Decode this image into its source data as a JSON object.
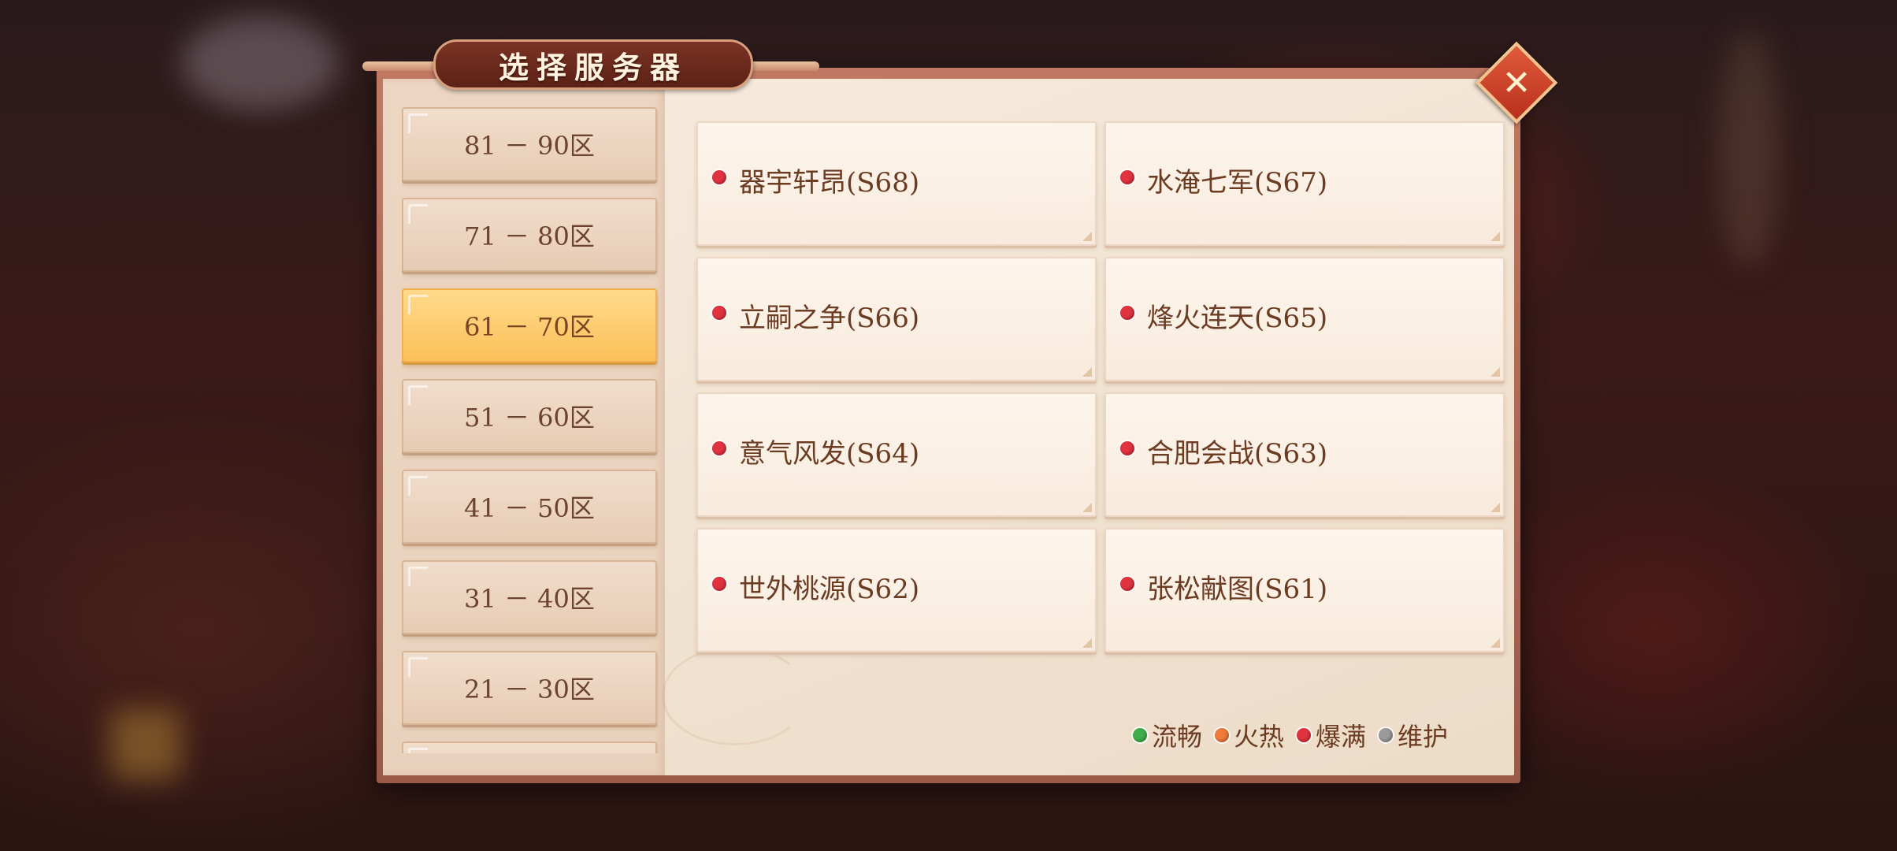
{
  "dialog": {
    "title": "选择服务器",
    "close_label": "✕"
  },
  "colors": {
    "selected_zone": "#fbc15a",
    "status_smooth": "#3fae49",
    "status_hot": "#ef7a3a",
    "status_full": "#e0333f",
    "status_maintenance": "#9a9a9a"
  },
  "zones": [
    {
      "label": "81 － 90区",
      "selected": false
    },
    {
      "label": "71 － 80区",
      "selected": false
    },
    {
      "label": "61 － 70区",
      "selected": true
    },
    {
      "label": "51 － 60区",
      "selected": false
    },
    {
      "label": "41 － 50区",
      "selected": false
    },
    {
      "label": "31 － 40区",
      "selected": false
    },
    {
      "label": "21 － 30区",
      "selected": false
    },
    {
      "label": "",
      "selected": false
    }
  ],
  "servers": [
    {
      "name": "器宇轩昂(S68)",
      "status": "full"
    },
    {
      "name": "水淹七军(S67)",
      "status": "full"
    },
    {
      "name": "立嗣之争(S66)",
      "status": "full"
    },
    {
      "name": "烽火连天(S65)",
      "status": "full"
    },
    {
      "name": "意气风发(S64)",
      "status": "full"
    },
    {
      "name": "合肥会战(S63)",
      "status": "full"
    },
    {
      "name": "世外桃源(S62)",
      "status": "full"
    },
    {
      "name": "张松献图(S61)",
      "status": "full"
    }
  ],
  "legend": [
    {
      "label": "流畅",
      "status": "smooth"
    },
    {
      "label": "火热",
      "status": "hot"
    },
    {
      "label": "爆满",
      "status": "full"
    },
    {
      "label": "维护",
      "status": "maintenance"
    }
  ]
}
